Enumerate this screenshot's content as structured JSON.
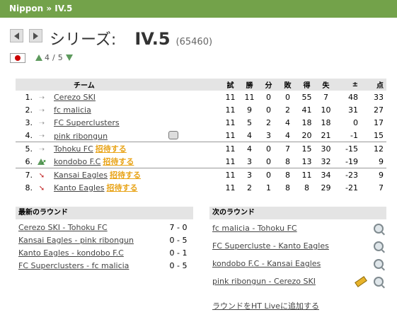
{
  "breadcrumb": {
    "league": "Nippon",
    "sep": "»",
    "level": "IV.5"
  },
  "header": {
    "series_label": "シリーズ:",
    "level_name": "IV.5",
    "league_id": "(65460)"
  },
  "country": {
    "flag": "japan-flag"
  },
  "pager": {
    "current": "4",
    "sep": "/",
    "total": "5"
  },
  "table": {
    "headers": {
      "team": "チーム",
      "played": "試",
      "won": "勝",
      "draw": "分",
      "lost": "敗",
      "gf": "得",
      "ga": "失",
      "diff": "±",
      "pts": "点"
    },
    "rows": [
      {
        "pos": "1.",
        "change": "same",
        "team": "Cerezo SKI",
        "invite": "",
        "p": "11",
        "w": "11",
        "d": "0",
        "l": "0",
        "gf": "55",
        "ga": "7",
        "diff": "48",
        "pts": "33",
        "icon": ""
      },
      {
        "pos": "2.",
        "change": "same",
        "team": "fc malicia",
        "invite": "",
        "p": "11",
        "w": "9",
        "d": "0",
        "l": "2",
        "gf": "41",
        "ga": "10",
        "diff": "31",
        "pts": "27",
        "icon": ""
      },
      {
        "pos": "3.",
        "change": "same",
        "team": "FC Superclusters",
        "invite": "",
        "p": "11",
        "w": "5",
        "d": "2",
        "l": "4",
        "gf": "18",
        "ga": "18",
        "diff": "0",
        "pts": "17",
        "icon": ""
      },
      {
        "pos": "4.",
        "change": "same",
        "team": "pink ribongun",
        "invite": "",
        "p": "11",
        "w": "4",
        "d": "3",
        "l": "4",
        "gf": "20",
        "ga": "21",
        "diff": "-1",
        "pts": "15",
        "icon": "message-icon"
      },
      {
        "pos": "5.",
        "change": "same",
        "team": "Tohoku FC",
        "invite": "招待する",
        "p": "11",
        "w": "4",
        "d": "0",
        "l": "7",
        "gf": "15",
        "ga": "30",
        "diff": "-15",
        "pts": "12",
        "icon": ""
      },
      {
        "pos": "6.",
        "change": "up",
        "team": "kondobo F.C",
        "invite": "招待する",
        "p": "11",
        "w": "3",
        "d": "0",
        "l": "8",
        "gf": "13",
        "ga": "32",
        "diff": "-19",
        "pts": "9",
        "icon": ""
      },
      {
        "pos": "7.",
        "change": "down",
        "team": "Kansai Eagles",
        "invite": "招待する",
        "p": "11",
        "w": "3",
        "d": "0",
        "l": "8",
        "gf": "11",
        "ga": "34",
        "diff": "-23",
        "pts": "9",
        "icon": ""
      },
      {
        "pos": "8.",
        "change": "down",
        "team": "Kanto Eagles",
        "invite": "招待する",
        "p": "11",
        "w": "2",
        "d": "1",
        "l": "8",
        "gf": "8",
        "ga": "29",
        "diff": "-21",
        "pts": "7",
        "icon": ""
      }
    ]
  },
  "latest_round": {
    "title": "最新のラウンド",
    "matches": [
      {
        "match": "Cerezo SKI - Tohoku FC",
        "score": "7 - 0"
      },
      {
        "match": "Kansai Eagles - pink ribongun",
        "score": "0 - 5"
      },
      {
        "match": "Kanto Eagles - kondobo F.C",
        "score": "0 - 1"
      },
      {
        "match": "FC Superclusters - fc malicia",
        "score": "0 - 5"
      }
    ]
  },
  "next_round": {
    "title": "次のラウンド",
    "matches": [
      {
        "match": "fc malicia - Tohoku FC"
      },
      {
        "match": "FC Supercluste - Kanto Eagles"
      },
      {
        "match": "kondobo F.C - Kansai Eagles"
      },
      {
        "match": "pink ribongun - Cerezo SKI"
      }
    ],
    "add_link": "ラウンドをHT Liveに追加する"
  },
  "colors": {
    "header_green": "#73a24a",
    "invite_orange": "#e8a317",
    "header_gray": "#e4e4e4"
  }
}
